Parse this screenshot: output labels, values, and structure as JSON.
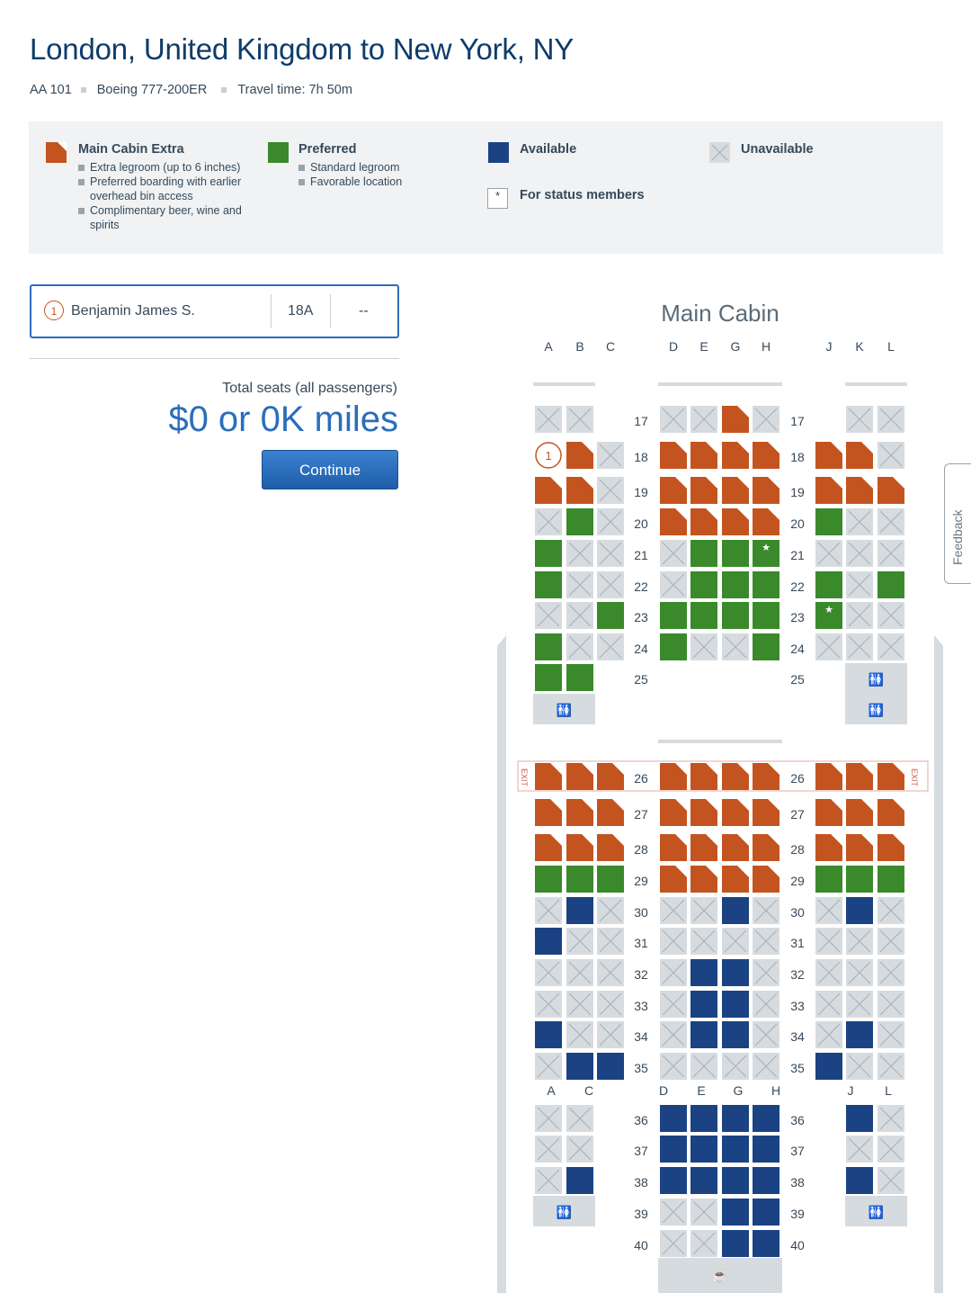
{
  "header": {
    "title": "London, United Kingdom to New York, NY",
    "flight": "AA 101",
    "aircraft": "Boeing 777-200ER",
    "travel_time": "Travel time: 7h 50m"
  },
  "legend": {
    "main_cabin_extra": {
      "title": "Main Cabin Extra",
      "color": "#c4541f",
      "bullets": [
        "Extra legroom (up to 6 inches)",
        "Preferred boarding with earlier overhead bin access",
        "Complimentary beer, wine and spirits"
      ]
    },
    "preferred": {
      "title": "Preferred",
      "color": "#3a8a2c",
      "bullets": [
        "Standard legroom",
        "Favorable location"
      ]
    },
    "available": {
      "title": "Available",
      "color": "#1b4384"
    },
    "unavailable": {
      "title": "Unavailable",
      "color": "#d6dbdf"
    },
    "status": {
      "title": "For status members",
      "symbol": "*"
    }
  },
  "passenger": {
    "number": "1",
    "name": "Benjamin James S.",
    "seat": "18A",
    "seat2": "--"
  },
  "totals": {
    "label": "Total seats (all passengers)",
    "value": "$0 or 0K miles"
  },
  "continue_label": "Continue",
  "feedback_label": "Feedback",
  "cabin": {
    "title": "Main Cabin",
    "columns_top": [
      "A",
      "B",
      "C",
      "D",
      "E",
      "G",
      "H",
      "J",
      "K",
      "L"
    ],
    "columns_mid": [
      "A",
      "C",
      "D",
      "E",
      "G",
      "H",
      "J",
      "L"
    ],
    "exit_label": "EXIT",
    "colors": {
      "extra": "#c4541f",
      "preferred": "#3a8a2c",
      "available": "#1b4384",
      "unavailable": "#d6dbdf"
    },
    "rows": [
      {
        "row": "17",
        "seats": "UU.UUEU.UU"
      },
      {
        "row": "18",
        "seats": "SEUEEEEEEU"
      },
      {
        "row": "19",
        "seats": "EEUEEEEEEE"
      },
      {
        "row": "20",
        "seats": "UPUEEEEPUU"
      },
      {
        "row": "21",
        "seats": "PUUUPPQUUU"
      },
      {
        "row": "22",
        "seats": "PUUUPPPPUP"
      },
      {
        "row": "23",
        "seats": "UUPPPPPQUU"
      },
      {
        "row": "24",
        "seats": "PUUPUUPUUU"
      },
      {
        "row": "25",
        "seats": "PP..........."
      },
      {
        "row": "26",
        "seats": "EEEEEEEEEE"
      },
      {
        "row": "27",
        "seats": "EEEEEEEEEE"
      },
      {
        "row": "28",
        "seats": "EEEEEEEEEE"
      },
      {
        "row": "29",
        "seats": "PPPEEEEPPP"
      },
      {
        "row": "30",
        "seats": "UAUUUAUUAU"
      },
      {
        "row": "31",
        "seats": "AUUUUUUUUU"
      },
      {
        "row": "32",
        "seats": "UUUUAAUUUU"
      },
      {
        "row": "33",
        "seats": "UUUUAAUUUU"
      },
      {
        "row": "34",
        "seats": "AUUUAAUUAU"
      },
      {
        "row": "35",
        "seats": "UAAUUUUAUU"
      },
      {
        "row": "36",
        "seats": "UU.AAAAAU"
      },
      {
        "row": "37",
        "seats": "UU.AAAAUU"
      },
      {
        "row": "38",
        "seats": "UA.AAAAAU"
      },
      {
        "row": "39",
        "seats": "...UUAA.."
      },
      {
        "row": "40",
        "seats": "...UUAA.."
      }
    ]
  }
}
